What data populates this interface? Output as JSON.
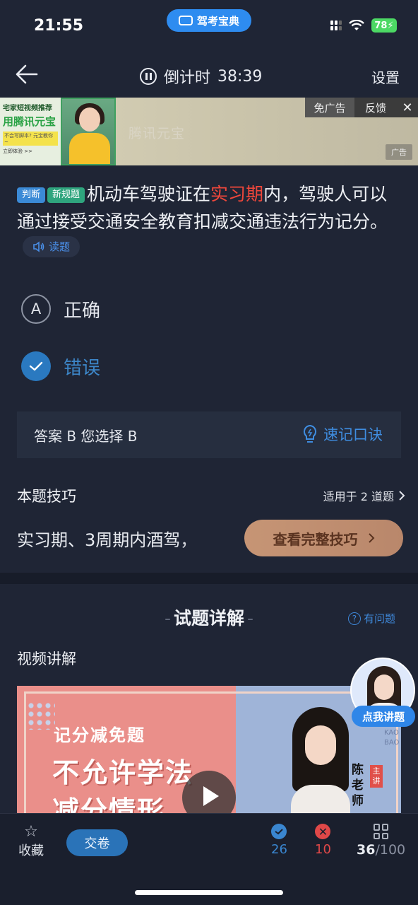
{
  "status_bar": {
    "time": "21:55",
    "app_name": "驾考宝典",
    "battery": "78"
  },
  "navbar": {
    "countdown_label": "倒计时",
    "countdown_value": "38:39",
    "settings_label": "设置"
  },
  "ad": {
    "left_line1": "宅家短视频推荐",
    "left_line2": "用腾讯元宝",
    "left_line3": "不会写脚本? 元宝教你~",
    "left_line4": "立即体验 >>",
    "brand": "腾讯元宝",
    "free_label": "免广告",
    "feedback_label": "反馈",
    "close_glyph": "✕",
    "ad_mark": "广告"
  },
  "question": {
    "tags": [
      "判断",
      "新规题"
    ],
    "text_before": "机动车驾驶证在",
    "highlight": "实习期",
    "text_after": "内，驾驶人可以通过接受交通安全教育扣减交通违法行为记分。",
    "read_label": "读题"
  },
  "options": [
    {
      "letter": "A",
      "text": "正确",
      "selected": false
    },
    {
      "letter": "B",
      "text": "错误",
      "selected": true
    }
  ],
  "answer": {
    "text": "答案 B 您选择 B",
    "memo_label": "速记口诀"
  },
  "tips": {
    "title": "本题技巧",
    "apply_label": "适用于 2 道题",
    "text": "实习期、3周期内酒驾，",
    "button_label": "查看完整技巧"
  },
  "detail": {
    "title": "试题详解",
    "ask_label": "有问题",
    "video_label": "视频讲解",
    "video_tag": "记分减免题",
    "video_big": "不允许学法",
    "video_big2": "减分情形",
    "teacher_name": "陈老师",
    "teacher_role": "主讲",
    "side_letters": "JIA KAO BAO",
    "lecture_label": "点我讲题"
  },
  "bottom": {
    "fav_label": "收藏",
    "submit_label": "交卷",
    "correct_count": "26",
    "wrong_count": "10",
    "current": "36",
    "total": "/100"
  }
}
